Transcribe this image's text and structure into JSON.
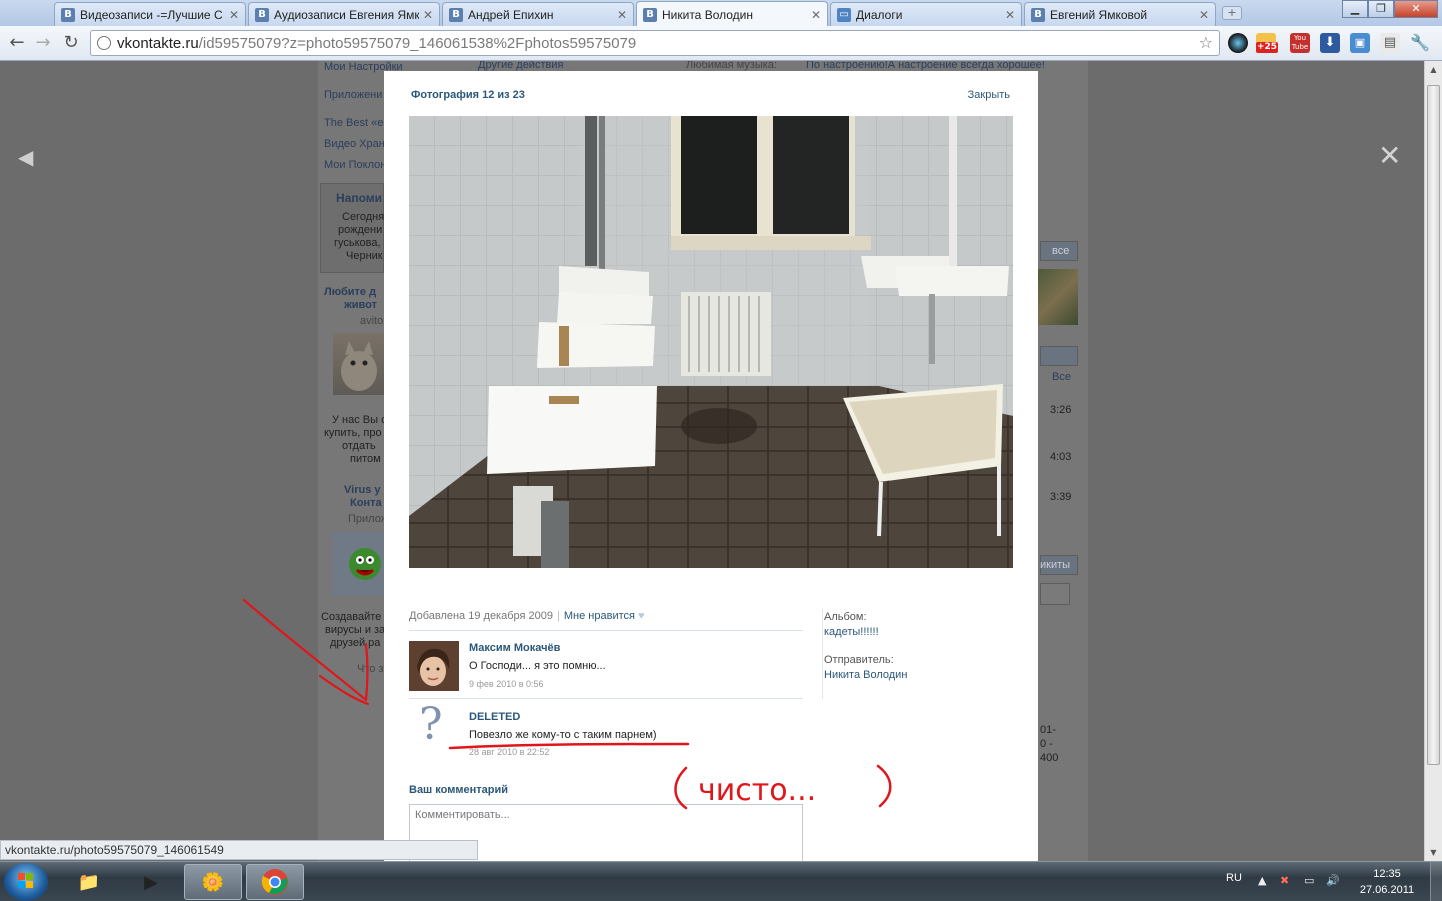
{
  "browser": {
    "tabs": [
      {
        "label": "Видеозаписи -=Лучшие С",
        "icon": "B"
      },
      {
        "label": "Аудиозаписи Евгения Ямк",
        "icon": "B"
      },
      {
        "label": "Андрей Епихин",
        "icon": "B"
      },
      {
        "label": "Никита Володин",
        "icon": "B"
      },
      {
        "label": "Диалоги",
        "icon": "chat"
      },
      {
        "label": "Евгений Ямковой",
        "icon": "B"
      }
    ],
    "active_tab": 3,
    "url_host": "vkontakte.ru",
    "url_path": "/id59575079?z=photo59575079_146061538%2Fphotos59575079",
    "ext_weather_badge": "+25",
    "ext_youtube": "You Tube"
  },
  "background_page": {
    "left_menu": [
      "Мои Настройки",
      "Приложени",
      "The Best «е",
      "Видео Хран",
      "Мои Поклон"
    ],
    "reminder_title": "Напоми",
    "reminder_lines": [
      "Сегодня",
      "рождени",
      "гуськова,",
      "Черник"
    ],
    "ad1_title": [
      "Любите д",
      "живот"
    ],
    "ad1_source": "avito",
    "ad1_text": [
      "У нас Вы с",
      "купить, про",
      "отдать",
      "питом"
    ],
    "ad2_title": [
      "Virus у",
      "Конта"
    ],
    "ad2_source": "Прилож",
    "ad2_text": [
      "Создавайте",
      "вирусы и за",
      "друзей ра",
      "Что з"
    ],
    "top_actions": "Другие действия",
    "music_label": "Любимая музыка:",
    "music_value": "По настроению!А настроение всегда хорошее!",
    "right_all_1": "все",
    "right_all_2": "Все",
    "right_times": [
      "3:26",
      "4:03",
      "3:39"
    ],
    "right_word": "икиты",
    "right_nums": [
      "01-",
      "0 -",
      "400"
    ]
  },
  "viewer": {
    "header": "Фотография 12 из 23",
    "close_label": "Закрыть",
    "added": "Добавлена 19 декабря 2009",
    "separator": "|",
    "dislike": "Мне нравится",
    "album_label": "Альбом:",
    "album_value": "кадеты!!!!!!",
    "sender_label": "Отправитель:",
    "sender_value": "Никита Володин",
    "comments": [
      {
        "author": "Максим Мокачёв",
        "text": "О Господи... я это помню...",
        "date": "9 фев 2010 в 0:56"
      },
      {
        "author": "DELETED",
        "text": "Повезло же кому-то с таким парнем)",
        "date": "28 авг 2010 в 22:52"
      }
    ],
    "your_comment_title": "Ваш комментарий",
    "comment_placeholder": "Комментировать..."
  },
  "annotation_text": "(чисто...)",
  "status_url": "vkontakte.ru/photo59575079_146061549",
  "taskbar": {
    "lang": "RU",
    "time": "12:35",
    "date": "27.06.2011"
  },
  "colors": {
    "vk_link": "#2b587a",
    "annotation_red": "#e0161b"
  }
}
